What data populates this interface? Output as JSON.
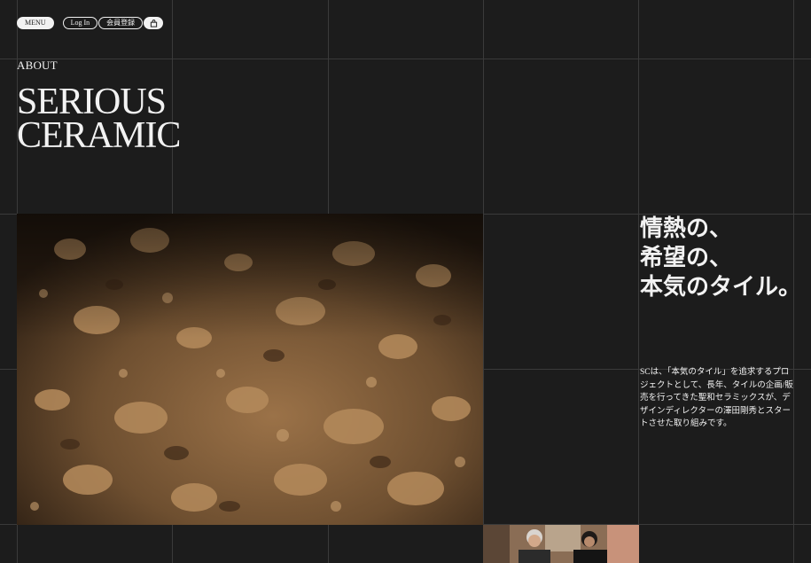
{
  "header": {
    "menu_label": "MENU",
    "login_label": "Log In",
    "register_label": "会員登録",
    "cart_icon": "shopping-bag-icon"
  },
  "main": {
    "section_label": "ABOUT",
    "title_line1": "SERIOUS",
    "title_line2": "CERAMIC",
    "tagline_line1": "情熱の、",
    "tagline_line2": "希望の、",
    "tagline_line3": "本気のタイル。",
    "description": "SCは、「本気のタイル」を追求するプロジェクトとして、長年、タイルの企画/販売を行ってきた聖和セラミックスが、デザインディレクターの澤田剛秀とスタートさせた取り組みです。"
  },
  "colors": {
    "background": "#1c1c1c",
    "grid_line": "#3a3a3a",
    "text": "#f2f2f2",
    "soil": "#7a5a38"
  }
}
